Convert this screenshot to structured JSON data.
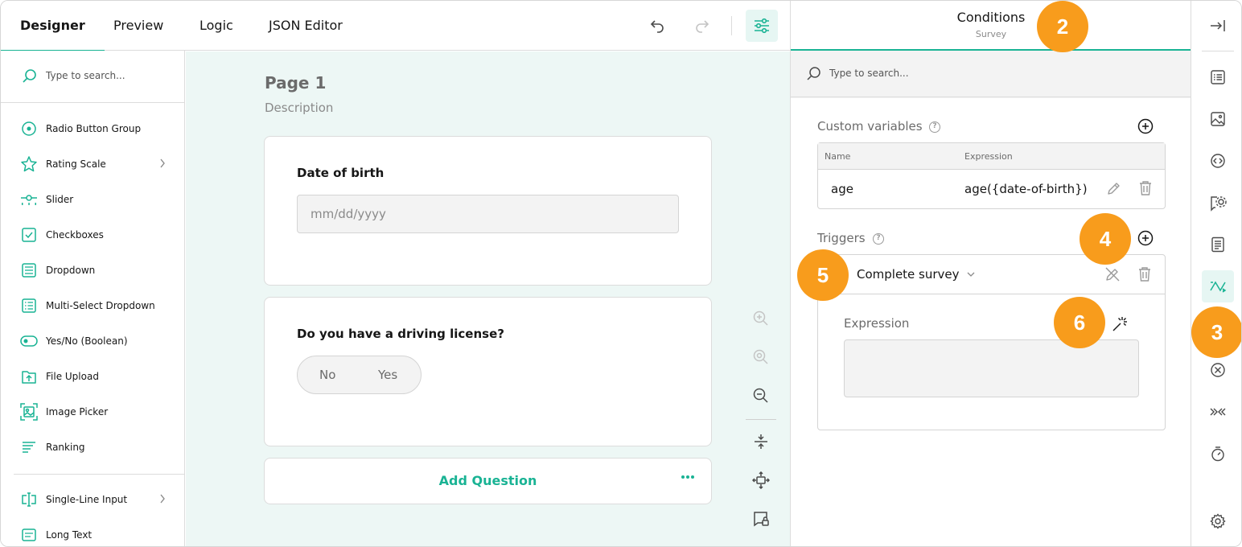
{
  "topbar": {
    "tabs": [
      {
        "label": "Designer",
        "active": true
      },
      {
        "label": "Preview",
        "active": false
      },
      {
        "label": "Logic",
        "active": false
      },
      {
        "label": "JSON Editor",
        "active": false
      }
    ],
    "icons": [
      "undo-icon",
      "redo-icon",
      "settings-sliders-icon"
    ]
  },
  "toolbox": {
    "search_placeholder": "Type to search...",
    "items": [
      {
        "label": "Radio Button Group",
        "icon": "radio-icon"
      },
      {
        "label": "Rating Scale",
        "icon": "star-icon",
        "has_submenu": true
      },
      {
        "label": "Slider",
        "icon": "slider-icon"
      },
      {
        "label": "Checkboxes",
        "icon": "checkbox-icon"
      },
      {
        "label": "Dropdown",
        "icon": "dropdown-icon"
      },
      {
        "label": "Multi-Select Dropdown",
        "icon": "multiselect-icon"
      },
      {
        "label": "Yes/No (Boolean)",
        "icon": "toggle-icon"
      },
      {
        "label": "File Upload",
        "icon": "file-upload-icon"
      },
      {
        "label": "Image Picker",
        "icon": "image-picker-icon"
      },
      {
        "label": "Ranking",
        "icon": "ranking-icon"
      },
      {
        "label": "Single-Line Input",
        "icon": "text-input-icon",
        "has_submenu": true
      },
      {
        "label": "Long Text",
        "icon": "long-text-icon"
      }
    ]
  },
  "canvas": {
    "page_title": "Page 1",
    "page_description": "Description",
    "questions": [
      {
        "title": "Date of birth",
        "placeholder": "mm/dd/yyyy"
      },
      {
        "title": "Do you have a driving license?",
        "options": [
          "No",
          "Yes"
        ]
      }
    ],
    "add_question_label": "Add Question",
    "more_label": "•••"
  },
  "property_grid": {
    "title": "Conditions",
    "subtitle": "Survey",
    "search_placeholder": "Type to search...",
    "custom_variables": {
      "title": "Custom variables",
      "columns": [
        "Name",
        "Expression"
      ],
      "rows": [
        {
          "name": "age",
          "expression": "age({date-of-birth})"
        }
      ]
    },
    "triggers": {
      "title": "Triggers",
      "items": [
        {
          "type": "Complete survey",
          "expression_label": "Expression",
          "expression_value": ""
        }
      ]
    }
  },
  "strip": {
    "icons": [
      "collapse-panel-icon",
      "general-icon",
      "logo-image-icon",
      "navigation-icon",
      "question-settings-icon",
      "pages-icon",
      "conditions-icon",
      "validation-icon",
      "data-icon",
      "quiz-mode-icon",
      "timer-icon",
      "settings-gear-icon"
    ],
    "active": "conditions-icon"
  },
  "callouts": [
    "2",
    "3",
    "4",
    "5",
    "6"
  ],
  "colors": {
    "accent": "#19b394",
    "callout": "#f89c1c",
    "canvas_bg": "#edf7f5"
  }
}
